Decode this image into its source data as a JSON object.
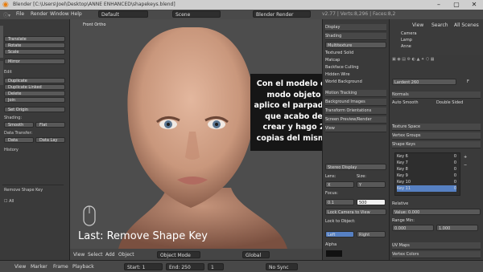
{
  "titlebar": {
    "title": "Blender [C:\\Users\\Joel\\Desktop\\ANNE ENHANCED\\shapekeys.blend]",
    "min": "–",
    "max": "▢",
    "close": "✕"
  },
  "menubar": {
    "items": [
      "File",
      "Render",
      "Window",
      "Help"
    ],
    "layout": "Default",
    "scene": "Scene",
    "engine": "Blender Render"
  },
  "toolshelf": {
    "transform_items": [
      "Translate",
      "Rotate",
      "Scale",
      "Mirror"
    ],
    "edit_label": "Edit",
    "edit_items": [
      "Duplicate",
      "Duplicate Linked",
      "Delete",
      "Join"
    ],
    "set_origin": "Set Origin",
    "shading_label": "Shading:",
    "smooth": "Smooth",
    "flat": "Flat",
    "data_transfer_label": "Data Transfer:",
    "data": "Data",
    "data_lay": "Data Lay",
    "history_label": "History",
    "remove_shape_key_label": "Remove Shape Key",
    "all_label": "All"
  },
  "viewport": {
    "label": "Front Ortho",
    "last_operator": "Last: Remove Shape Key"
  },
  "overlay": {
    "lines": [
      "Con el modelo en",
      "modo objeto",
      "aplico el parpadeo",
      "que acabo de",
      "crear y hago 2",
      "copias del mismo"
    ]
  },
  "props": {
    "display": "Display",
    "shading": "Shading",
    "multitexture": "Multitexture",
    "textured_solid": "Textured Solid",
    "matcap": "Matcap",
    "backface_culling": "Backface Culling",
    "hidden_wire": "Hidden Wire",
    "world_bg": "World Background",
    "motion_tracking": "Motion Tracking",
    "bg_images": "Background Images",
    "transform_orient": "Transform Orientations",
    "screen_preview": "Screen Preview/Render",
    "view": "View",
    "lens_label": "Lens:",
    "size_label": "Size:",
    "focus_label": "Focus:",
    "clip_start": "Clip Start",
    "clip_end": "Clip End",
    "x_label": "X",
    "y_label": "Y",
    "start_val": "0.1",
    "end_val": "500",
    "lock_label": "Lock to Object:",
    "lock_camera": "Lock Camera to View",
    "stereo": "Stereo Display",
    "left": "Left",
    "right": "Right",
    "clip_alpha": "Alpha",
    "shift_label": "Shift:",
    "reset": "Reset"
  },
  "outliner": {
    "tabs": [
      "View",
      "Search",
      "All Scenes"
    ],
    "items": [
      "Camera",
      "Lamp",
      "Anne"
    ]
  },
  "propeditor": {
    "object_name": "Lardent 260",
    "mesh_label": "F",
    "normals": "Normals",
    "auto_smooth": "Auto Smooth",
    "double_sided": "Double Sided",
    "texture_space": "Texture Space",
    "vertex_groups": "Vertex Groups",
    "shape_keys": "Shape Keys",
    "keys": [
      {
        "name": "Key 6",
        "value": "0"
      },
      {
        "name": "Key 7",
        "value": "0"
      },
      {
        "name": "Key 8",
        "value": "0"
      },
      {
        "name": "Key 9",
        "value": "0"
      },
      {
        "name": "Key 10",
        "value": "0"
      },
      {
        "name": "Key 11",
        "value": "0"
      }
    ],
    "relative": "Relative",
    "value_label": "Value:",
    "value": "0.000",
    "range_min": "Range Min:",
    "range_max": "Max:",
    "min_val": "0.000",
    "max_val": "1.000",
    "vertex_group": "Vertex Group",
    "relative_to": "Relative To",
    "basis": "Basis",
    "uv_maps": "UV Maps",
    "vertex_colors": "Vertex Colors",
    "geometry_data": "Geometry Data"
  },
  "vp_header": {
    "items": [
      "View",
      "Select",
      "Add",
      "Object"
    ],
    "mode": "Object Mode",
    "pivot": "Global"
  },
  "timeline": {
    "items": [
      "View",
      "Marker",
      "Frame",
      "Playback"
    ],
    "start_label": "Start:",
    "start": "1",
    "end_label": "End:",
    "end": "250",
    "current": "1",
    "sync": "No Sync"
  }
}
